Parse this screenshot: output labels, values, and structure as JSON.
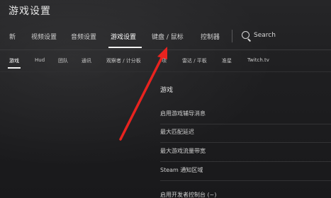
{
  "window": {
    "title": "游戏设置"
  },
  "top_nav": {
    "items": [
      {
        "label": "新"
      },
      {
        "label": "视频设置"
      },
      {
        "label": "音频设置"
      },
      {
        "label": "游戏设置"
      },
      {
        "label": "键盘 / 鼠标"
      },
      {
        "label": "控制器"
      }
    ],
    "active_index": 3,
    "search": {
      "label": "Search",
      "icon": "search-icon"
    }
  },
  "sub_nav": {
    "items": [
      {
        "label": "游戏"
      },
      {
        "label": "Hud"
      },
      {
        "label": "团队"
      },
      {
        "label": "通讯"
      },
      {
        "label": "观察者 / 计分板"
      },
      {
        "label": "项"
      },
      {
        "label": "雷达 / 平板"
      },
      {
        "label": "准星"
      },
      {
        "label": "Twitch.tv"
      }
    ],
    "active_index": 0
  },
  "panel": {
    "section_title": "游戏",
    "rows": [
      {
        "label": "启用游戏辅导消息"
      },
      {
        "label": "最大匹配延迟"
      },
      {
        "label": "最大游戏流量带宽"
      },
      {
        "label": "Steam 通知区域"
      },
      {
        "label": "启用开发者控制台 (~)"
      }
    ]
  },
  "annotation": {
    "arrow_color": "#e8231f"
  }
}
